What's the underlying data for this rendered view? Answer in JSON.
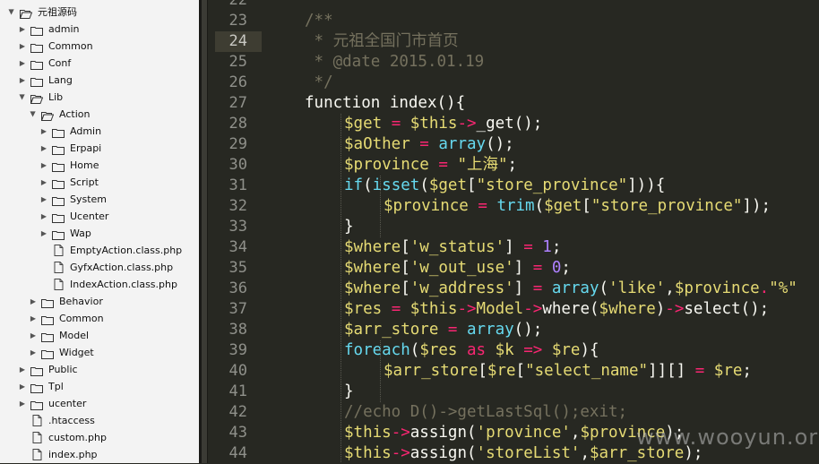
{
  "sidebar": {
    "items": [
      {
        "label": "元祖源码",
        "type": "folder",
        "expanded": true,
        "depth": 0
      },
      {
        "label": "admin",
        "type": "folder",
        "expanded": false,
        "depth": 1
      },
      {
        "label": "Common",
        "type": "folder",
        "expanded": false,
        "depth": 1
      },
      {
        "label": "Conf",
        "type": "folder",
        "expanded": false,
        "depth": 1
      },
      {
        "label": "Lang",
        "type": "folder",
        "expanded": false,
        "depth": 1
      },
      {
        "label": "Lib",
        "type": "folder",
        "expanded": true,
        "depth": 1
      },
      {
        "label": "Action",
        "type": "folder",
        "expanded": true,
        "depth": 2
      },
      {
        "label": "Admin",
        "type": "folder",
        "expanded": false,
        "depth": 3
      },
      {
        "label": "Erpapi",
        "type": "folder",
        "expanded": false,
        "depth": 3
      },
      {
        "label": "Home",
        "type": "folder",
        "expanded": false,
        "depth": 3
      },
      {
        "label": "Script",
        "type": "folder",
        "expanded": false,
        "depth": 3
      },
      {
        "label": "System",
        "type": "folder",
        "expanded": false,
        "depth": 3
      },
      {
        "label": "Ucenter",
        "type": "folder",
        "expanded": false,
        "depth": 3
      },
      {
        "label": "Wap",
        "type": "folder",
        "expanded": false,
        "depth": 3
      },
      {
        "label": "EmptyAction.class.php",
        "type": "file",
        "depth": 3
      },
      {
        "label": "GyfxAction.class.php",
        "type": "file",
        "depth": 3
      },
      {
        "label": "IndexAction.class.php",
        "type": "file",
        "depth": 3
      },
      {
        "label": "Behavior",
        "type": "folder",
        "expanded": false,
        "depth": 2
      },
      {
        "label": "Common",
        "type": "folder",
        "expanded": false,
        "depth": 2
      },
      {
        "label": "Model",
        "type": "folder",
        "expanded": false,
        "depth": 2
      },
      {
        "label": "Widget",
        "type": "folder",
        "expanded": false,
        "depth": 2
      },
      {
        "label": "Public",
        "type": "folder",
        "expanded": false,
        "depth": 1
      },
      {
        "label": "Tpl",
        "type": "folder",
        "expanded": false,
        "depth": 1
      },
      {
        "label": "ucenter",
        "type": "folder",
        "expanded": false,
        "depth": 1
      },
      {
        "label": ".htaccess",
        "type": "file",
        "depth": 1
      },
      {
        "label": "custom.php",
        "type": "file",
        "depth": 1
      },
      {
        "label": "index.php",
        "type": "file",
        "depth": 1
      }
    ]
  },
  "editor": {
    "active_line": "24",
    "line_numbers": [
      "22",
      "23",
      "24",
      "25",
      "26",
      "27",
      "28",
      "29",
      "30",
      "31",
      "32",
      "33",
      "34",
      "35",
      "36",
      "37",
      "38",
      "39",
      "40",
      "41",
      "42",
      "43",
      "44"
    ],
    "lines": [
      {
        "indent": 0,
        "tokens": []
      },
      {
        "indent": 0,
        "tokens": [
          [
            "/**",
            "comment"
          ]
        ]
      },
      {
        "indent": 0,
        "tokens": [
          [
            " * 元祖全国门市首页",
            "comment"
          ]
        ]
      },
      {
        "indent": 0,
        "tokens": [
          [
            " * @date 2015.01.19",
            "comment"
          ]
        ]
      },
      {
        "indent": 0,
        "tokens": [
          [
            " */",
            "comment"
          ]
        ]
      },
      {
        "indent": 0,
        "tokens": [
          [
            "function index(){",
            "plain"
          ]
        ]
      },
      {
        "indent": 1,
        "tokens": [
          [
            "$get",
            "var"
          ],
          [
            " = ",
            "op"
          ],
          [
            "$this",
            "var"
          ],
          [
            "->",
            "op"
          ],
          [
            "_get",
            "plain"
          ],
          [
            "();",
            "plain"
          ]
        ]
      },
      {
        "indent": 1,
        "tokens": [
          [
            "$aOther",
            "var"
          ],
          [
            " = ",
            "op"
          ],
          [
            "array",
            "func"
          ],
          [
            "();",
            "plain"
          ]
        ]
      },
      {
        "indent": 1,
        "tokens": [
          [
            "$province",
            "var"
          ],
          [
            " = ",
            "op"
          ],
          [
            "\"上海\"",
            "str"
          ],
          [
            ";",
            "plain"
          ]
        ]
      },
      {
        "indent": 1,
        "tokens": [
          [
            "if",
            "func"
          ],
          [
            "(",
            "plain"
          ],
          [
            "isset",
            "func"
          ],
          [
            "(",
            "plain"
          ],
          [
            "$get",
            "var"
          ],
          [
            "[",
            "plain"
          ],
          [
            "\"store_province\"",
            "str"
          ],
          [
            "])){",
            "plain"
          ]
        ]
      },
      {
        "indent": 2,
        "tokens": [
          [
            "$province",
            "var"
          ],
          [
            " = ",
            "op"
          ],
          [
            "trim",
            "func"
          ],
          [
            "(",
            "plain"
          ],
          [
            "$get",
            "var"
          ],
          [
            "[",
            "plain"
          ],
          [
            "\"store_province\"",
            "str"
          ],
          [
            "]);",
            "plain"
          ]
        ]
      },
      {
        "indent": 1,
        "tokens": [
          [
            "}",
            "plain"
          ]
        ]
      },
      {
        "indent": 1,
        "tokens": [
          [
            "$where",
            "var"
          ],
          [
            "[",
            "plain"
          ],
          [
            "'w_status'",
            "str"
          ],
          [
            "] ",
            "plain"
          ],
          [
            "= ",
            "op"
          ],
          [
            "1",
            "num"
          ],
          [
            ";",
            "plain"
          ]
        ]
      },
      {
        "indent": 1,
        "tokens": [
          [
            "$where",
            "var"
          ],
          [
            "[",
            "plain"
          ],
          [
            "'w_out_use'",
            "str"
          ],
          [
            "] ",
            "plain"
          ],
          [
            "= ",
            "op"
          ],
          [
            "0",
            "num"
          ],
          [
            ";",
            "plain"
          ]
        ]
      },
      {
        "indent": 1,
        "tokens": [
          [
            "$where",
            "var"
          ],
          [
            "[",
            "plain"
          ],
          [
            "'w_address'",
            "str"
          ],
          [
            "] ",
            "plain"
          ],
          [
            "= ",
            "op"
          ],
          [
            "array",
            "func"
          ],
          [
            "(",
            "plain"
          ],
          [
            "'like'",
            "str"
          ],
          [
            ",",
            "plain"
          ],
          [
            "$province",
            "var"
          ],
          [
            ".",
            "op"
          ],
          [
            "\"%\"",
            "str"
          ]
        ]
      },
      {
        "indent": 1,
        "tokens": [
          [
            "$res",
            "var"
          ],
          [
            " = ",
            "op"
          ],
          [
            "$this",
            "var"
          ],
          [
            "->",
            "op"
          ],
          [
            "Model",
            "var"
          ],
          [
            "->",
            "op"
          ],
          [
            "where",
            "plain"
          ],
          [
            "(",
            "plain"
          ],
          [
            "$where",
            "var"
          ],
          [
            ")",
            "plain"
          ],
          [
            "->",
            "op"
          ],
          [
            "select",
            "plain"
          ],
          [
            "();",
            "plain"
          ]
        ]
      },
      {
        "indent": 1,
        "tokens": [
          [
            "$arr_store",
            "var"
          ],
          [
            " = ",
            "op"
          ],
          [
            "array",
            "func"
          ],
          [
            "();",
            "plain"
          ]
        ]
      },
      {
        "indent": 1,
        "tokens": [
          [
            "foreach",
            "func"
          ],
          [
            "(",
            "plain"
          ],
          [
            "$res",
            "var"
          ],
          [
            " as ",
            "op"
          ],
          [
            "$k",
            "var"
          ],
          [
            " => ",
            "op"
          ],
          [
            "$re",
            "var"
          ],
          [
            "){",
            "plain"
          ]
        ]
      },
      {
        "indent": 2,
        "tokens": [
          [
            "$arr_store",
            "var"
          ],
          [
            "[",
            "plain"
          ],
          [
            "$re",
            "var"
          ],
          [
            "[",
            "plain"
          ],
          [
            "\"select_name\"",
            "str"
          ],
          [
            "]][] ",
            "plain"
          ],
          [
            "= ",
            "op"
          ],
          [
            "$re",
            "var"
          ],
          [
            ";",
            "plain"
          ]
        ]
      },
      {
        "indent": 1,
        "tokens": [
          [
            "}",
            "plain"
          ]
        ]
      },
      {
        "indent": 1,
        "tokens": [
          [
            "//echo D()->getLastSql();exit;",
            "comment"
          ]
        ]
      },
      {
        "indent": 1,
        "tokens": [
          [
            "$this",
            "var"
          ],
          [
            "->",
            "op"
          ],
          [
            "assign",
            "plain"
          ],
          [
            "(",
            "plain"
          ],
          [
            "'province'",
            "str"
          ],
          [
            ",",
            "plain"
          ],
          [
            "$province",
            "var"
          ],
          [
            ");",
            "plain"
          ]
        ]
      },
      {
        "indent": 1,
        "tokens": [
          [
            "$this",
            "var"
          ],
          [
            "->",
            "op"
          ],
          [
            "assign",
            "plain"
          ],
          [
            "(",
            "plain"
          ],
          [
            "'storeList'",
            "str"
          ],
          [
            ",",
            "plain"
          ],
          [
            "$arr_store",
            "var"
          ],
          [
            ");",
            "plain"
          ]
        ]
      }
    ]
  },
  "colors": {
    "comment": "#75715e",
    "var": "#e6db74",
    "str": "#e6db74",
    "op": "#f92672",
    "func": "#66d9ef",
    "num": "#ae81ff",
    "plain": "#f8f8f2",
    "folder_icon": "#333333",
    "file_icon": "#444444"
  },
  "watermark": "www.wooyun.org"
}
